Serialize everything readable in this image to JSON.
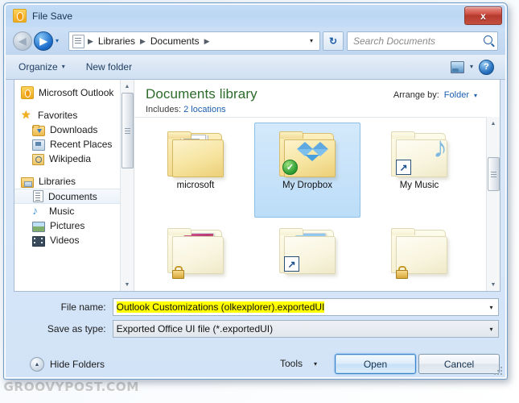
{
  "window": {
    "title": "File Save",
    "app_icon": "outlook-icon",
    "close_label": "x"
  },
  "navbar": {
    "back_icon": "back-arrow-icon",
    "forward_icon": "forward-arrow-icon",
    "recent_caret": "▾",
    "crumbs": [
      "Libraries",
      "Documents"
    ],
    "crumb_sep": "▶",
    "crumb_dropdown": "▾",
    "refresh_icon": "↻",
    "search_placeholder": "Search Documents"
  },
  "toolbar": {
    "organize": "Organize",
    "new_folder": "New folder",
    "caret": "▾",
    "view_icon": "view-mode-icon",
    "view_caret": "▾",
    "help": "?"
  },
  "sidebar": {
    "items": [
      {
        "label": "Microsoft Outlook",
        "icon": "outlook-icon",
        "indent": false,
        "selected": false,
        "gap_after": true
      },
      {
        "label": "Favorites",
        "icon": "star-icon",
        "indent": false,
        "selected": false
      },
      {
        "label": "Downloads",
        "icon": "downloads-folder-icon",
        "indent": true,
        "selected": false
      },
      {
        "label": "Recent Places",
        "icon": "recent-places-icon",
        "indent": true,
        "selected": false
      },
      {
        "label": "Wikipedia",
        "icon": "wikipedia-search-icon",
        "indent": true,
        "selected": false,
        "gap_after": true
      },
      {
        "label": "Libraries",
        "icon": "libraries-icon",
        "indent": false,
        "selected": false
      },
      {
        "label": "Documents",
        "icon": "document-icon",
        "indent": true,
        "selected": true
      },
      {
        "label": "Music",
        "icon": "music-note-icon",
        "indent": true,
        "selected": false
      },
      {
        "label": "Pictures",
        "icon": "pictures-icon",
        "indent": true,
        "selected": false
      },
      {
        "label": "Videos",
        "icon": "videos-icon",
        "indent": true,
        "selected": false
      }
    ]
  },
  "library": {
    "title": "Documents library",
    "includes_label": "Includes:",
    "includes_value": "2 locations",
    "arrange_label": "Arrange by:",
    "arrange_value": "Folder",
    "arrange_caret": "▾"
  },
  "files": [
    {
      "name": "microsoft",
      "type": "folder-documents",
      "selected": false,
      "overlay": "none"
    },
    {
      "name": "My Dropbox",
      "type": "folder-dropbox",
      "selected": true,
      "overlay": "sync-check"
    },
    {
      "name": "My Music",
      "type": "folder-music",
      "selected": false,
      "overlay": "shortcut"
    },
    {
      "name": "",
      "type": "folder-art",
      "selected": false,
      "overlay": "lock"
    },
    {
      "name": "",
      "type": "folder-photo",
      "selected": false,
      "overlay": "shortcut"
    },
    {
      "name": "",
      "type": "folder-plain",
      "selected": false,
      "overlay": "lock"
    }
  ],
  "form": {
    "filename_label": "File name:",
    "filename_value": "Outlook Customizations (olkexplorer).exportedUI",
    "filename_highlighted": true,
    "savetype_label": "Save as type:",
    "savetype_value": "Exported Office UI file (*.exportedUI)",
    "dropdown_caret": "▾"
  },
  "footer": {
    "hide_folders": "Hide Folders",
    "hide_folders_icon": "▲",
    "tools": "Tools",
    "tools_caret": "▾",
    "open": "Open",
    "cancel": "Cancel"
  },
  "watermark": "GROOVYPOST.COM",
  "colors": {
    "title_bar": "#bdd7f4",
    "accent_blue": "#1b5fb0",
    "library_green": "#2c6b2a",
    "selection_blue": "#bcddf8",
    "highlight_yellow": "#ffff00",
    "close_red": "#b63a2e"
  }
}
